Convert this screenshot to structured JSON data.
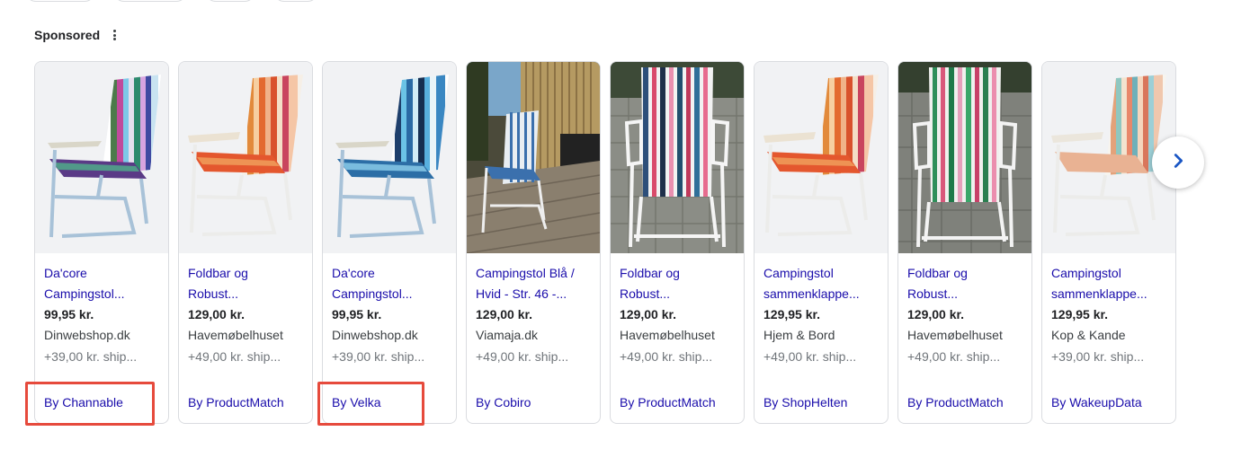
{
  "header": {
    "sponsored_label": "Sponsored",
    "menu_icon": "more-vert-icon"
  },
  "products": [
    {
      "title_line1": "Da'core",
      "title_line2": "Campingstol...",
      "price": "99,95 kr.",
      "merchant": "Dinwebshop.dk",
      "shipping": "+39,00 kr. ship...",
      "by": "By Channable",
      "image": "striped-folding-chair-colorful",
      "highlighted": true
    },
    {
      "title_line1": "Foldbar og",
      "title_line2": "Robust...",
      "price": "129,00 kr.",
      "merchant": "Havemøbelhuset",
      "shipping": "+49,00 kr. ship...",
      "by": "By ProductMatch",
      "image": "striped-folding-chair-orange"
    },
    {
      "title_line1": "Da'core",
      "title_line2": "Campingstol...",
      "price": "99,95 kr.",
      "merchant": "Dinwebshop.dk",
      "shipping": "+39,00 kr. ship...",
      "by": "By Velka",
      "image": "striped-folding-chair-blue",
      "highlighted": true
    },
    {
      "title_line1": "Campingstol Blå /",
      "title_line2": "Hvid - Str. 46 -...",
      "price": "129,00 kr.",
      "merchant": "Viamaja.dk",
      "shipping": "+49,00 kr. ship...",
      "by": "By Cobiro",
      "image": "folding-chair-on-deck-photo"
    },
    {
      "title_line1": "Foldbar og",
      "title_line2": "Robust...",
      "price": "129,00 kr.",
      "merchant": "Havemøbelhuset",
      "shipping": "+49,00 kr. ship...",
      "by": "By ProductMatch",
      "image": "folding-chair-on-paving-photo"
    },
    {
      "title_line1": "Campingstol",
      "title_line2": "sammenklappe...",
      "price": "129,95 kr.",
      "merchant": "Hjem & Bord",
      "shipping": "+49,00 kr. ship...",
      "by": "By ShopHelten",
      "image": "striped-folding-chair-orange"
    },
    {
      "title_line1": "Foldbar og",
      "title_line2": "Robust...",
      "price": "129,00 kr.",
      "merchant": "Havemøbelhuset",
      "shipping": "+49,00 kr. ship...",
      "by": "By ProductMatch",
      "image": "folding-chair-green-stripes-photo"
    },
    {
      "title_line1": "Campingstol",
      "title_line2": "sammenklappe...",
      "price": "129,95 kr.",
      "merchant": "Kop & Kande",
      "shipping": "+39,00 kr. ship...",
      "by": "By WakeupData",
      "image": "striped-folding-chair-pastel"
    }
  ],
  "carousel": {
    "next_icon": "chevron-right-icon"
  },
  "colors": {
    "link": "#1a0dab",
    "highlight_border": "#e64a3c",
    "card_border": "#dadce0"
  }
}
